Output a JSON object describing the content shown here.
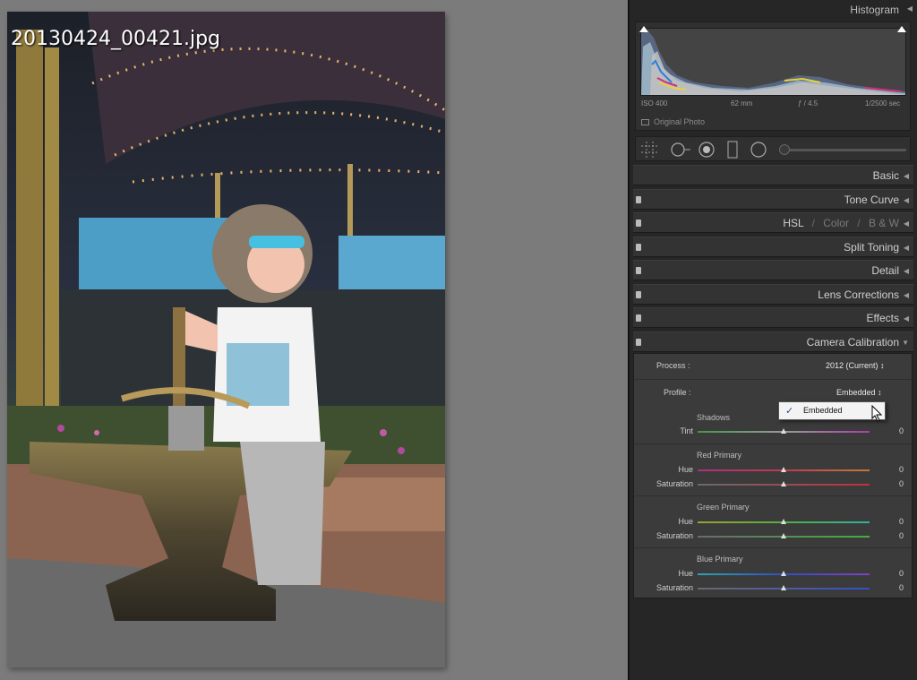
{
  "photo": {
    "filename": "20130424_00421.jpg"
  },
  "histogram": {
    "title": "Histogram",
    "iso": "ISO 400",
    "focal_length": "62 mm",
    "aperture": "ƒ / 4.5",
    "shutter": "1/2500 sec",
    "original_photo_label": "Original Photo"
  },
  "panels": {
    "basic": "Basic",
    "tone_curve": "Tone Curve",
    "hsl": "HSL",
    "sep1": "/",
    "color": "Color",
    "sep2": "/",
    "bw": "B & W",
    "split_toning": "Split Toning",
    "detail": "Detail",
    "lens_corrections": "Lens Corrections",
    "effects": "Effects",
    "camera_calibration": "Camera Calibration"
  },
  "calibration": {
    "process_label": "Process :",
    "process_value": "2012 (Current) ↕",
    "profile_label": "Profile :",
    "profile_value": "Embedded ↕",
    "dropdown_option": "Embedded",
    "dropdown_check": "✓",
    "shadows": {
      "title": "Shadows",
      "tint_label": "Tint",
      "tint": "0"
    },
    "red": {
      "title": "Red Primary",
      "hue_label": "Hue",
      "hue": "0",
      "sat_label": "Saturation",
      "sat": "0"
    },
    "green": {
      "title": "Green Primary",
      "hue_label": "Hue",
      "hue": "0",
      "sat_label": "Saturation",
      "sat": "0"
    },
    "blue": {
      "title": "Blue Primary",
      "hue_label": "Hue",
      "hue": "0",
      "sat_label": "Saturation",
      "sat": "0"
    }
  }
}
